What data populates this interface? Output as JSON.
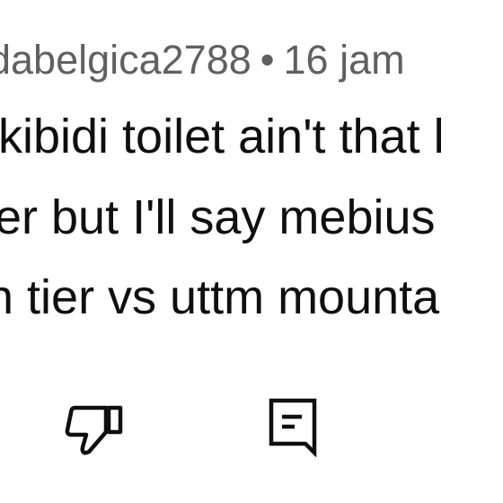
{
  "comment": {
    "author": "dabelgica2788",
    "separator": "•",
    "time": "16 jam",
    "lines": [
      "kibidi toilet ain't that l",
      "er but I'll say mebius",
      "n tier vs uttm mounta"
    ]
  },
  "actions": {
    "dislike_icon": "thumbs-down-outline",
    "reply_icon": "comment-outline"
  },
  "colors": {
    "background": "#ffffff",
    "meta_text": "#606060",
    "body_text": "#0f0f0f",
    "icon_stroke": "#0f0f0f"
  }
}
